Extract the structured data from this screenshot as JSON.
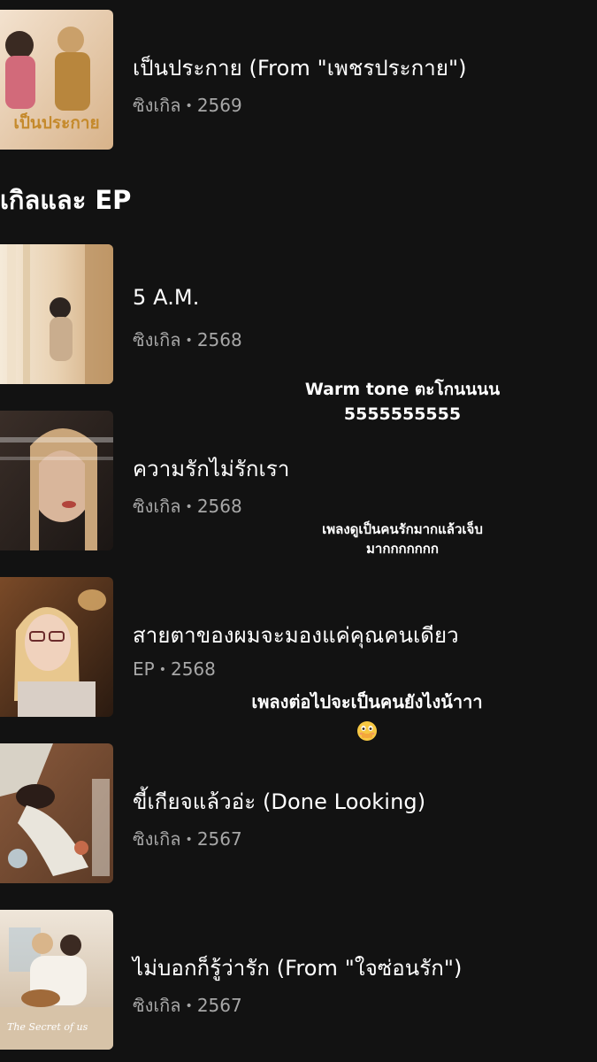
{
  "section": {
    "title": "เกิลและ EP"
  },
  "tracks": [
    {
      "title": "เป็นประกาย (From \"เพชรประกาย\")",
      "type": "ซิงเกิล",
      "year": "2569",
      "cover_text": "เป็นประกาย"
    },
    {
      "title": "5 A.M.",
      "type": "ซิงเกิล",
      "year": "2568",
      "cover_text": ""
    },
    {
      "title": "ความรักไม่รักเรา",
      "type": "ซิงเกิล",
      "year": "2568",
      "cover_text": ""
    },
    {
      "title": "สายตาของผมจะมองแค่คุณคนเดียว",
      "type": "EP",
      "year": "2568",
      "cover_text": ""
    },
    {
      "title": "ขี้เกียจแล้วอ่ะ (Done Looking)",
      "type": "ซิงเกิล",
      "year": "2567",
      "cover_text": ""
    },
    {
      "title": "ไม่บอกก็รู้ว่ารัก (From \"ใจซ่อนรัก\")",
      "type": "ซิงเกิล",
      "year": "2567",
      "cover_text": "The Secret of us"
    }
  ],
  "overlays": {
    "caption1_line1": "Warm tone ตะโกนนนน",
    "caption1_line2": "5555555555",
    "caption2_line1": "เพลงดูเป็นคนรักมากแล้วเจ็บ",
    "caption2_line2": "มากกกกกกก",
    "caption3_line1": "เพลงต่อไปจะเป็นคนยังไงน้าาา",
    "caption3_emoji": "flushed-face-emoji"
  },
  "meta_separator": "•",
  "colors": {
    "background": "#121212",
    "title": "#ffffff",
    "meta": "#a7a7a7"
  }
}
